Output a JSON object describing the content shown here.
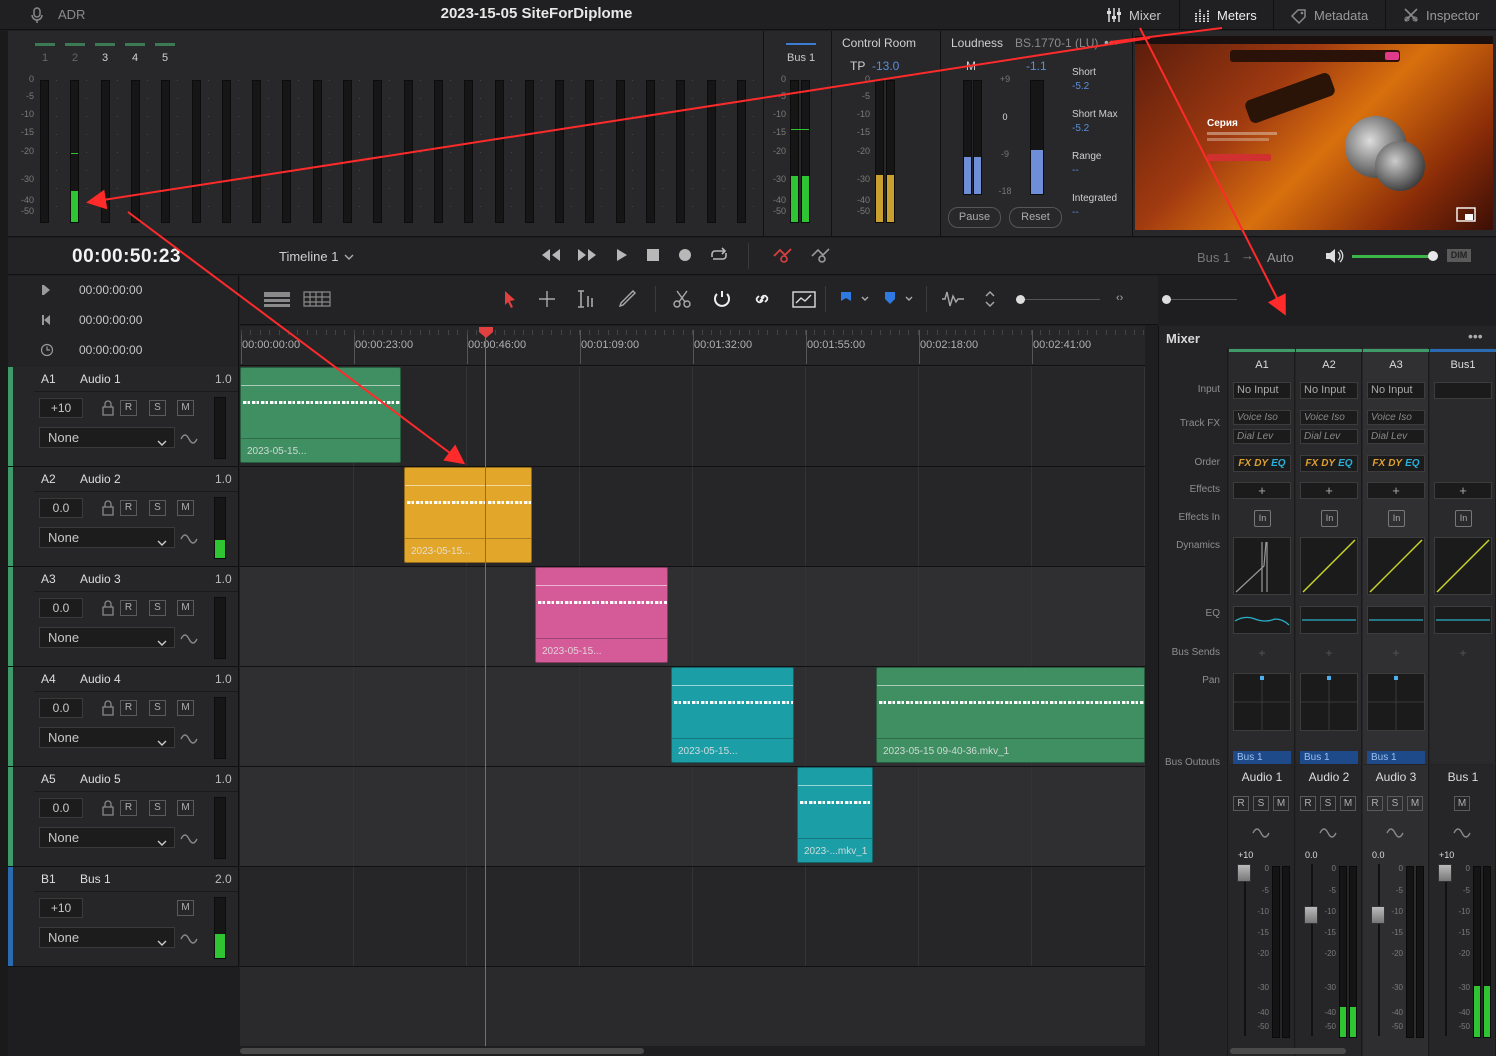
{
  "top": {
    "adr_label": "ADR",
    "project_title": "2023-15-05 SiteForDiplome",
    "buttons": [
      "Mixer",
      "Meters",
      "Metadata",
      "Inspector"
    ]
  },
  "meters": {
    "channel_numbers": [
      "1",
      "2",
      "3",
      "4",
      "5"
    ],
    "scale": [
      "0",
      "-5",
      "-10",
      "-15",
      "-20",
      "-30",
      "-40",
      "-50"
    ],
    "bus_label": "Bus 1",
    "control_room": "Control Room",
    "tp_label": "TP",
    "tp_value": "-13.0",
    "loudness_label": "Loudness",
    "loudness_standard": "BS.1770-1 (LU)",
    "m_label": "M",
    "m_value": "-1.1",
    "loud_scale": [
      "+9",
      "0",
      "-9",
      "-18"
    ],
    "short_label": "Short",
    "short_value": "-5.2",
    "short_max_label": "Short Max",
    "short_max_value": "-5.2",
    "range_label": "Range",
    "range_value": "--",
    "integrated_label": "Integrated",
    "integrated_value": "--",
    "pause_label": "Pause",
    "reset_label": "Reset",
    "preview_title": "Серия"
  },
  "transport": {
    "timecode": "00:00:50:23",
    "timeline_name": "Timeline 1",
    "bus_label": "Bus 1",
    "auto_label": "Auto",
    "dim_label": "DIM"
  },
  "side_timecodes": [
    "00:00:00:00",
    "00:00:00:00",
    "00:00:00:00"
  ],
  "ruler_labels": [
    "00:00:00:00",
    "00:00:23:00",
    "00:00:46:00",
    "00:01:09:00",
    "00:01:32:00",
    "00:01:55:00",
    "00:02:18:00",
    "00:02:41:00"
  ],
  "tracks": [
    {
      "id": "A1",
      "name": "Audio 1",
      "gain": "1.0",
      "vol": "+10",
      "input": "None",
      "color": "#3f9a6a",
      "level": 0
    },
    {
      "id": "A2",
      "name": "Audio 2",
      "gain": "1.0",
      "vol": "0.0",
      "input": "None",
      "color": "#3f9a6a",
      "level": 0.3
    },
    {
      "id": "A3",
      "name": "Audio 3",
      "gain": "1.0",
      "vol": "0.0",
      "input": "None",
      "color": "#3f9a6a",
      "level": 0
    },
    {
      "id": "A4",
      "name": "Audio 4",
      "gain": "1.0",
      "vol": "0.0",
      "input": "None",
      "color": "#3f9a6a",
      "level": 0
    },
    {
      "id": "A5",
      "name": "Audio 5",
      "gain": "1.0",
      "vol": "0.0",
      "input": "None",
      "color": "#3f9a6a",
      "level": 0
    },
    {
      "id": "B1",
      "name": "Bus 1",
      "gain": "2.0",
      "vol": "+10",
      "input": "None",
      "color": "#2a6ab0",
      "level": 0.4
    }
  ],
  "clips": [
    {
      "label": "2023-05-15...",
      "color": "#3f8f62"
    },
    {
      "label": "2023-05-15...",
      "color": "#e2a72a"
    },
    {
      "label": "2023-05-15...",
      "color": "#d45a98"
    },
    {
      "label": "2023-05-15...",
      "color": "#1c9ea6"
    },
    {
      "label": "2023-05-15 09-40-36.mkv_1",
      "color": "#3f8f62"
    },
    {
      "label": "2023-...mkv_1",
      "color": "#1c9ea6"
    }
  ],
  "mixer": {
    "title": "Mixer",
    "columns": [
      "A1",
      "A2",
      "A3",
      "Bus1"
    ],
    "row_labels": [
      "Input",
      "Track FX",
      "Order",
      "Effects",
      "Effects In",
      "Dynamics",
      "EQ",
      "Bus Sends",
      "Pan",
      "Bus Outputs"
    ],
    "input_value": "No Input",
    "fx1": "Voice Iso",
    "fx2": "Dial Lev",
    "order_fx": "FX",
    "order_dy": "DY",
    "order_eq": "EQ",
    "plus": "+",
    "in": "In",
    "bus_out": "Bus 1",
    "strip_names": [
      "Audio 1",
      "Audio 2",
      "Audio 3",
      "Bus 1"
    ],
    "strip_vols": [
      "+10",
      "0.0",
      "0.0",
      "+10"
    ],
    "fader_scale": [
      "0",
      "-5",
      "-10",
      "-15",
      "-20",
      "-30",
      "-40",
      "-50"
    ],
    "strip_levels": [
      0,
      0.18,
      0,
      0.3
    ]
  }
}
